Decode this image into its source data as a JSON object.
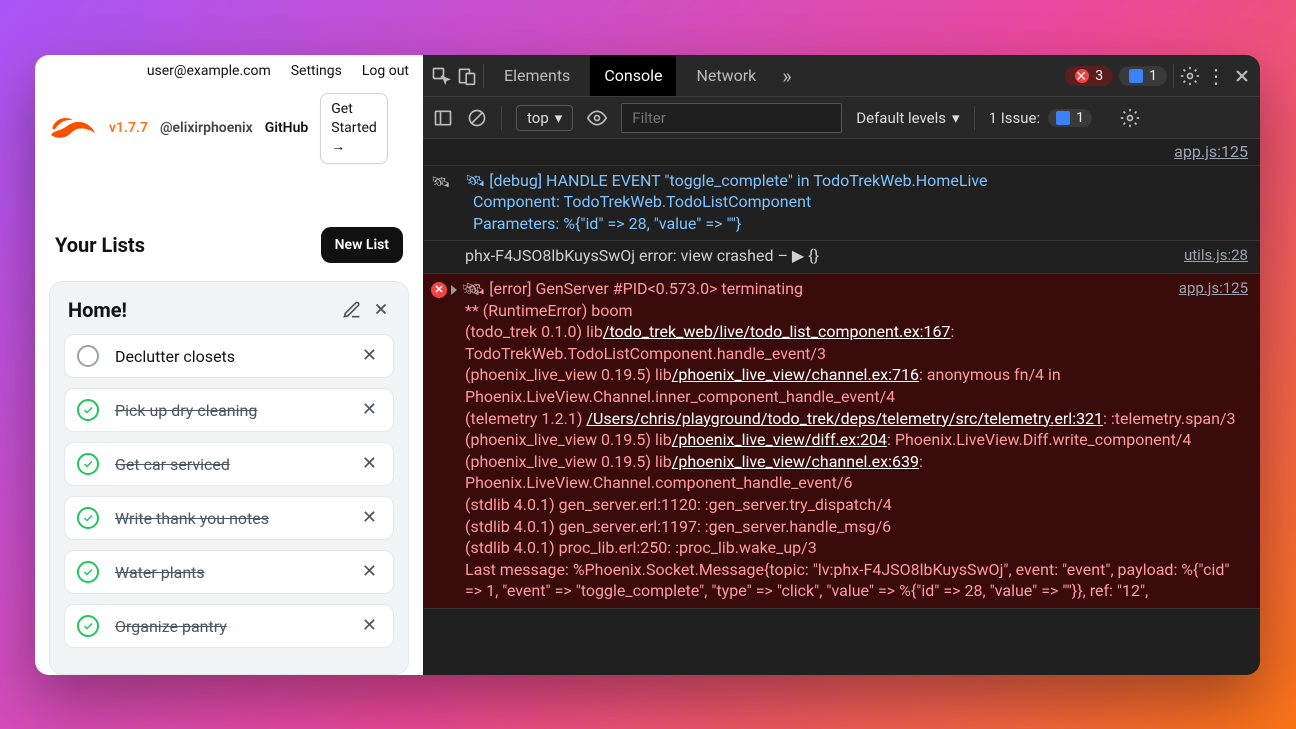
{
  "app": {
    "user_email": "user@example.com",
    "nav": {
      "settings": "Settings",
      "logout": "Log out"
    },
    "version": "v1.7.7",
    "handle": "@elixirphoenix",
    "github": "GitHub",
    "get_started": "Get\nStarted\n→",
    "lists_heading": "Your Lists",
    "new_list": "New List",
    "list_title": "Home!",
    "todos": [
      {
        "label": "Declutter closets",
        "done": false
      },
      {
        "label": "Pick up dry cleaning",
        "done": true
      },
      {
        "label": "Get car serviced",
        "done": true
      },
      {
        "label": "Write thank you notes",
        "done": true
      },
      {
        "label": "Water plants",
        "done": true
      },
      {
        "label": "Organize pantry",
        "done": true
      }
    ]
  },
  "devtools": {
    "tabs": {
      "elements": "Elements",
      "console": "Console",
      "network": "Network"
    },
    "error_count": "3",
    "info_count": "1",
    "context": "top",
    "filter_placeholder": "Filter",
    "levels": "Default levels",
    "issues_label": "1 Issue:",
    "issues_count": "1",
    "rows": {
      "r0_src": "app.js:125",
      "r0_text": "🛰 [debug] HANDLE EVENT \"toggle_complete\" in TodoTrekWeb.HomeLive\n  Component: TodoTrekWeb.TodoListComponent\n  Parameters: %{\"id\" => 28, \"value\" => \"\"}",
      "r1_src": "utils.js:28",
      "r1_text": "phx-F4JSO8lbKuysSwOj error: view crashed –  ▶ {}",
      "r2_src": "app.js:125",
      "r2_head": "🛰 [error] GenServer #PID<0.573.0> terminating",
      "r2_l1": "** (RuntimeError) boom",
      "r2_l2a": "    (todo_trek 0.1.0) lib",
      "r2_l2b": "/todo_trek_web/live/todo_list_component.ex:167",
      "r2_l2c": ": TodoTrekWeb.TodoListComponent.handle_event/3",
      "r2_l3a": "    (phoenix_live_view 0.19.5) lib",
      "r2_l3b": "/phoenix_live_view/channel.ex:716",
      "r2_l3c": ": anonymous fn/4 in Phoenix.LiveView.Channel.inner_component_handle_event/4",
      "r2_l4a": "    (telemetry 1.2.1) ",
      "r2_l4b": "/Users/chris/playground/todo_trek/deps/telemetry/src/telemetry.erl:321",
      "r2_l4c": ": :telemetry.span/3",
      "r2_l5a": "    (phoenix_live_view 0.19.5) lib",
      "r2_l5b": "/phoenix_live_view/diff.ex:204",
      "r2_l5c": ": Phoenix.LiveView.Diff.write_component/4",
      "r2_l6a": "    (phoenix_live_view 0.19.5) lib",
      "r2_l6b": "/phoenix_live_view/channel.ex:639",
      "r2_l6c": ": Phoenix.LiveView.Channel.component_handle_event/6",
      "r2_l7": "    (stdlib 4.0.1) gen_server.erl:1120: :gen_server.try_dispatch/4",
      "r2_l8": "    (stdlib 4.0.1) gen_server.erl:1197: :gen_server.handle_msg/6",
      "r2_l9": "    (stdlib 4.0.1) proc_lib.erl:250: :proc_lib.wake_up/3",
      "r2_last": "Last message: %Phoenix.Socket.Message{topic: \"lv:phx-F4JSO8lbKuysSwOj\", event: \"event\", payload: %{\"cid\" => 1, \"event\" => \"toggle_complete\", \"type\" => \"click\", \"value\" => %{\"id\" => 28, \"value\" => \"\"}}, ref: \"12\","
    }
  }
}
